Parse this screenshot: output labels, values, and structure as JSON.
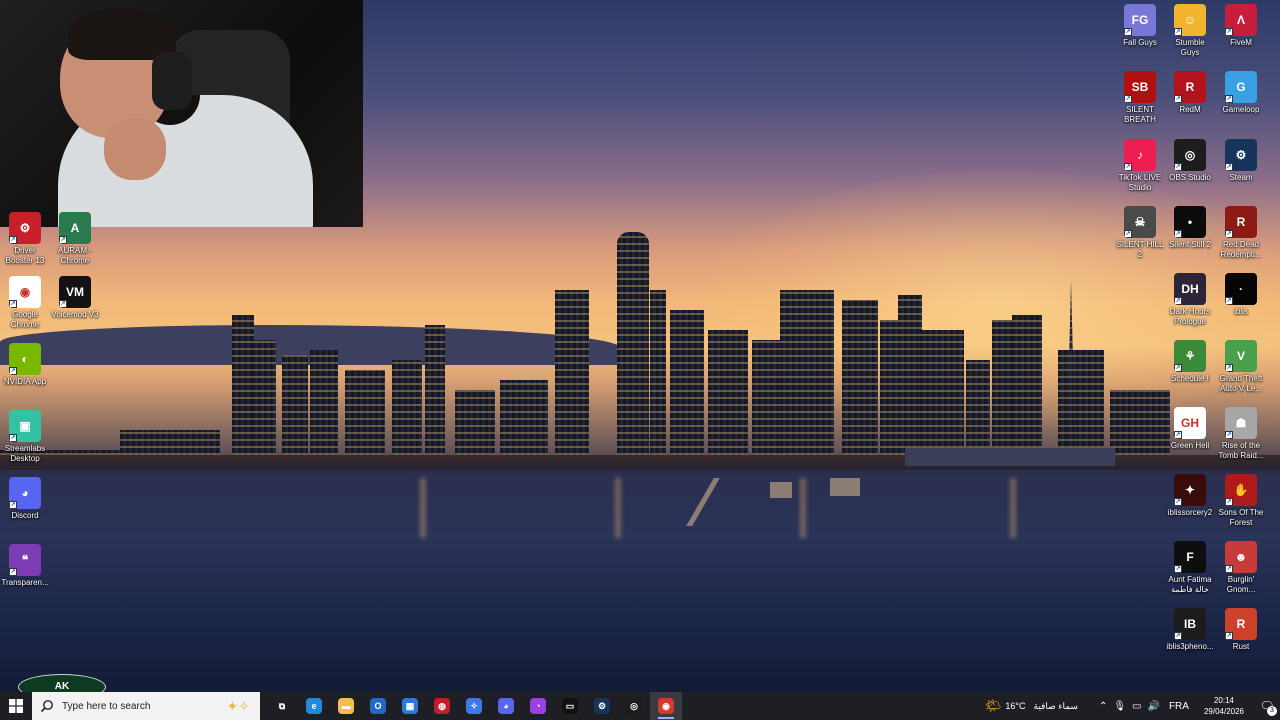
{
  "desktop": {
    "icons_left": [
      {
        "label": "Driver Booster 13",
        "glyph": "⚙",
        "bg": "#c8202a"
      },
      {
        "label": "AURAM - Chrome",
        "glyph": "A",
        "bg": "#2a7a4e"
      },
      {
        "label": "Google Chrome",
        "glyph": "◉",
        "bg": "#ffffff"
      },
      {
        "label": "Voicemod V3",
        "glyph": "VM",
        "bg": "#121212"
      },
      {
        "label": "NVIDIA App",
        "glyph": "◐",
        "bg": "#76b900"
      },
      {
        "label": "Streamlabs Desktop",
        "glyph": "▣",
        "bg": "#31c3a2"
      },
      {
        "label": "Discord",
        "glyph": "◕",
        "bg": "#5865f2"
      },
      {
        "label": "Transparen...",
        "glyph": "❝",
        "bg": "#7d3cb5"
      }
    ],
    "icons_right": [
      {
        "label": "Fall Guys",
        "glyph": "FG",
        "bg": "#7a78d6"
      },
      {
        "label": "Stumble Guys",
        "glyph": "☺",
        "bg": "#f1b42e"
      },
      {
        "label": "FiveM",
        "glyph": "Λ",
        "bg": "#c91e3b"
      },
      {
        "label": "SILENT BREATH",
        "glyph": "SB",
        "bg": "#b01010"
      },
      {
        "label": "RedM",
        "glyph": "R",
        "bg": "#b3141c"
      },
      {
        "label": "Gameloop",
        "glyph": "G",
        "bg": "#3aa0e6"
      },
      {
        "label": "TikTok LIVE Studio",
        "glyph": "♪",
        "bg": "#ee1d52"
      },
      {
        "label": "OBS Studio",
        "glyph": "◎",
        "bg": "#1d1d1d"
      },
      {
        "label": "Steam",
        "glyph": "⚙",
        "bg": "#17355a"
      },
      {
        "label": "SILENT HILL 2",
        "glyph": "☠",
        "bg": "#4a4a4a"
      },
      {
        "label": "Silent Still 2",
        "glyph": "•",
        "bg": "#0b0b0b"
      },
      {
        "label": "Red Dead Redempti...",
        "glyph": "R",
        "bg": "#8c1b16"
      },
      {
        "label": "Dark Hours Prologue",
        "glyph": "DH",
        "bg": "#2c2438"
      },
      {
        "label": "iblis",
        "glyph": "·",
        "bg": "#050505"
      },
      {
        "label": "Schedule I",
        "glyph": "⚘",
        "bg": "#3a8a3a"
      },
      {
        "label": "Grand Theft Auto V Le...",
        "glyph": "V",
        "bg": "#4aa04a"
      },
      {
        "label": "Green Hell",
        "glyph": "GH",
        "bg": "#ffffff"
      },
      {
        "label": "Rise of the Tomb Raid...",
        "glyph": "☗",
        "bg": "#a7a7a7"
      },
      {
        "label": "iblissorcery2",
        "glyph": "✦",
        "bg": "#3a0b0b"
      },
      {
        "label": "Sons Of The Forest",
        "glyph": "✋",
        "bg": "#b01a1a"
      },
      {
        "label": "Aunt Fatima خالة فاطمة",
        "glyph": "F",
        "bg": "#0e0e0e"
      },
      {
        "label": "Burglin' Gnom...",
        "glyph": "☻",
        "bg": "#c73b3b"
      },
      {
        "label": "iblis3pheno...",
        "glyph": "IB",
        "bg": "#1c1c1c"
      },
      {
        "label": "Rust",
        "glyph": "R",
        "bg": "#cd412b"
      }
    ],
    "logo_text": "AK"
  },
  "taskbar": {
    "search_placeholder": "Type here to search",
    "apps": [
      {
        "name": "task-view",
        "glyph": "⧉",
        "bg": "transparent"
      },
      {
        "name": "edge",
        "glyph": "e",
        "bg": "#1f8ad9"
      },
      {
        "name": "file-explorer",
        "glyph": "▬",
        "bg": "#f2c04a"
      },
      {
        "name": "outlook",
        "glyph": "O",
        "bg": "#2268c8"
      },
      {
        "name": "store",
        "glyph": "▦",
        "bg": "#2b78d6"
      },
      {
        "name": "stopwatch",
        "glyph": "◍",
        "bg": "#c01f2a"
      },
      {
        "name": "copilot",
        "glyph": "✧",
        "bg": "#3d7ae8"
      },
      {
        "name": "discord",
        "glyph": "◕",
        "bg": "#5865f2"
      },
      {
        "name": "messenger",
        "glyph": "◔",
        "bg": "#9b3fe6"
      },
      {
        "name": "nvidia",
        "glyph": "▭",
        "bg": "#111111"
      },
      {
        "name": "steam",
        "glyph": "⚙",
        "bg": "#17355a"
      },
      {
        "name": "obs",
        "glyph": "◎",
        "bg": "#1d1d1d"
      },
      {
        "name": "chrome",
        "glyph": "◉",
        "bg": "#d23a2f"
      }
    ],
    "weather": {
      "temp": "16°C",
      "condition": "سماء صافية"
    },
    "language": "FRA",
    "time": "20:14",
    "date": "29/04/2026",
    "notification_count": "3"
  }
}
